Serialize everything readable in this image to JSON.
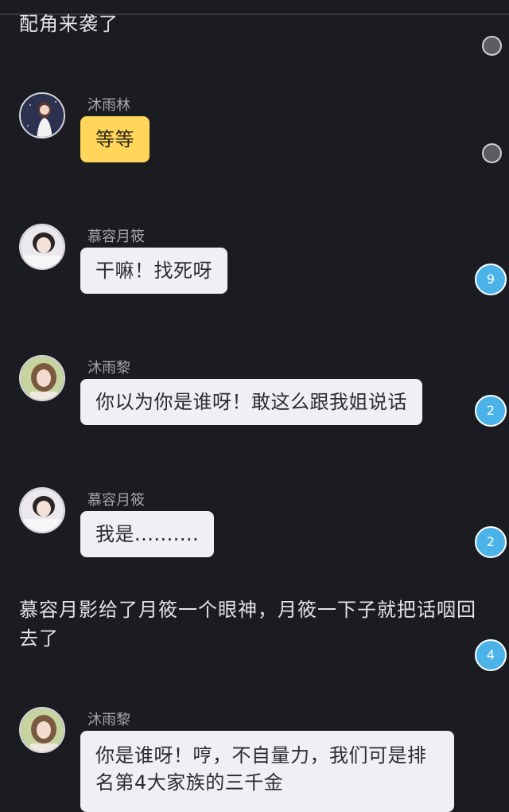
{
  "narrations": [
    "配角来袭了",
    "慕容月影给了月筱一个眼神，月筱一下子就把话咽回去了"
  ],
  "messages": [
    {
      "sender": "沐雨林",
      "text": "等等",
      "bubble_color": "#ffd659",
      "avatar_tone": "#3a3f5c"
    },
    {
      "sender": "慕容月筱",
      "text": "干嘛！找死呀",
      "bubble_color": "#eef0f5",
      "avatar_tone": "#e7e5ea"
    },
    {
      "sender": "沐雨黎",
      "text": "你以为你是谁呀！敢这么跟我姐说话",
      "bubble_color": "#eef0f5",
      "avatar_tone": "#c9d7a6"
    },
    {
      "sender": "慕容月筱",
      "text": "我是..........",
      "bubble_color": "#eef0f5",
      "avatar_tone": "#e7e5ea"
    },
    {
      "sender": "沐雨黎",
      "text": "你是谁呀！哼，不自量力，我们可是排名第4大家族的三千金",
      "bubble_color": "#eef0f5",
      "avatar_tone": "#c9d7a6"
    }
  ],
  "comment_badges": [
    "9",
    "2",
    "2",
    "4"
  ],
  "colors": {
    "background": "#1b1c21",
    "badge": "#4cb3e8",
    "highlight_bubble": "#ffd659",
    "bubble": "#eef0f5"
  }
}
